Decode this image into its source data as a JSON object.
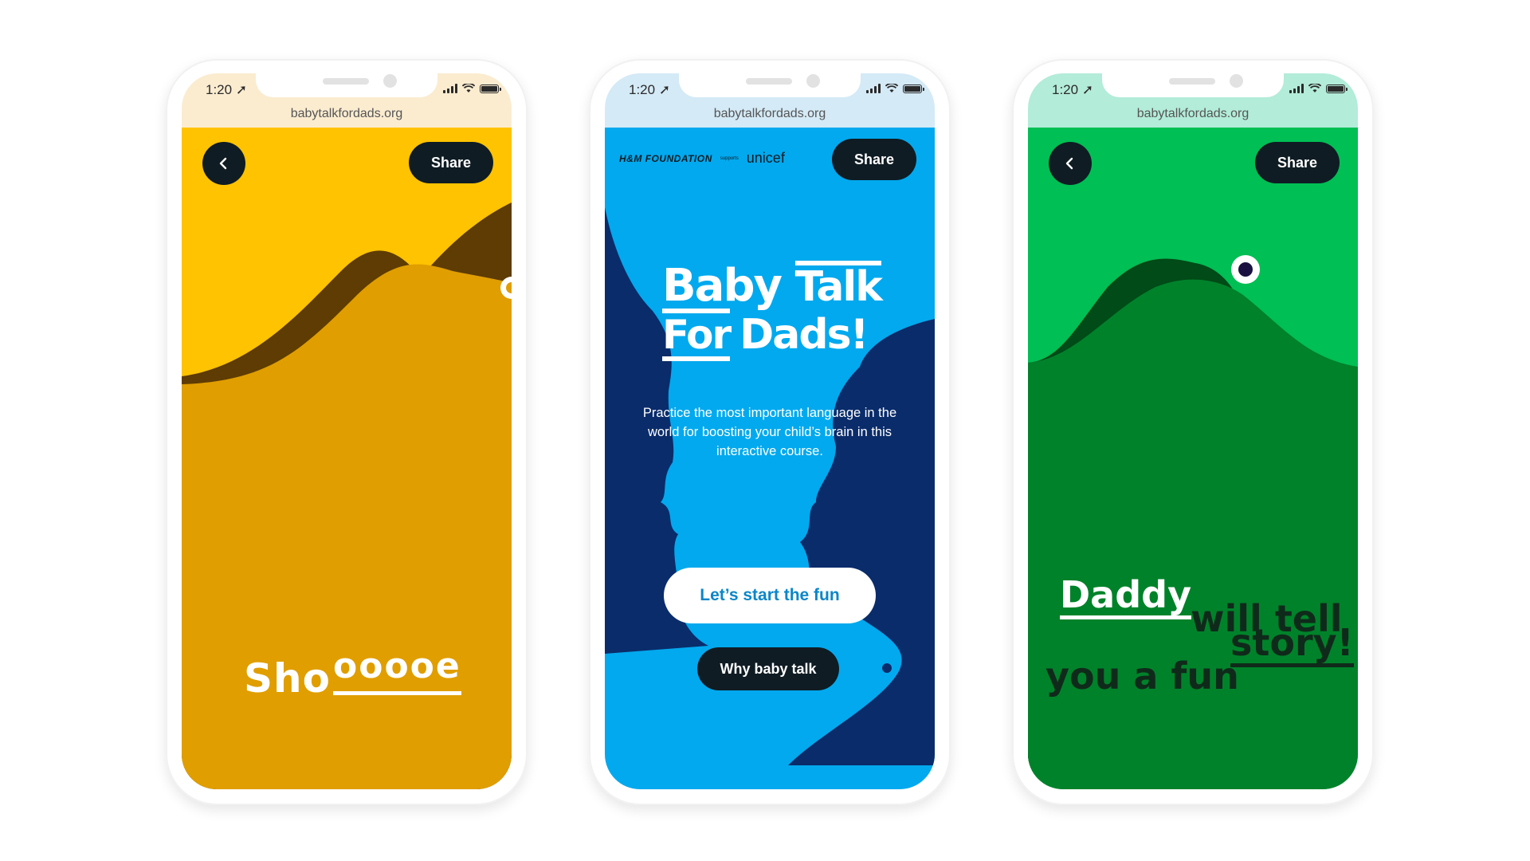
{
  "status_bar": {
    "time": "1:20"
  },
  "url": "babytalkfordads.org",
  "phones": [
    {
      "share_label": "Share",
      "word_plain": "Sho",
      "word_underlined": "ooooe"
    },
    {
      "share_label": "Share",
      "brand": {
        "foundation": "H&M FOUNDATION",
        "supports": "supports",
        "unicef": "unicef"
      },
      "logo": {
        "w1": "Baby",
        "w2": "Talk",
        "w3": "For",
        "w4": "Dads!"
      },
      "intro": "Practice the most important language in the world for boosting your child’s brain in this interactive course.",
      "cta_label": "Let’s start the fun",
      "why_label": "Why baby talk"
    },
    {
      "share_label": "Share",
      "line1_underlined": "Daddy",
      "line1_rest": "will tell",
      "line2_plain": "you a fun",
      "line2_underlined": "story!"
    }
  ],
  "colors": {
    "yellow_bg": "#ffc301",
    "yellow_dark": "#e09e00",
    "brown": "#5e3c04",
    "blue_bg": "#02a9ee",
    "navy": "#0a2c6b",
    "green_bg": "#00bf54",
    "green_dark": "#00822a",
    "button_dark": "#0f1c24"
  },
  "icons": [
    "back-arrow-icon",
    "signal-icon",
    "wifi-icon",
    "battery-icon",
    "location-arrow-icon"
  ]
}
